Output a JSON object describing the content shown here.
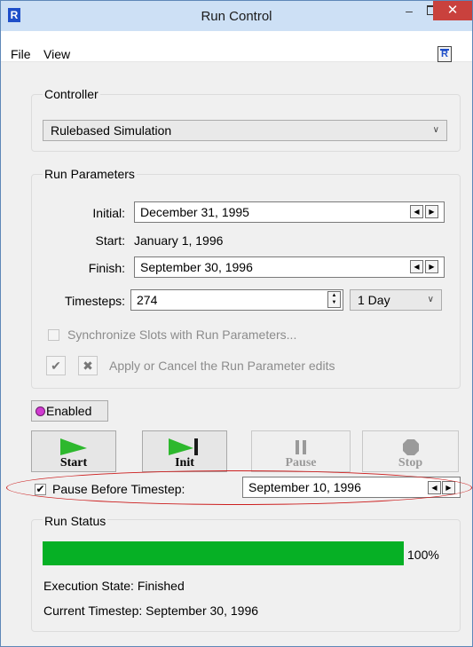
{
  "window": {
    "title": "Run Control",
    "app_icon_letter": "R",
    "minimize_glyph": "–",
    "close_glyph": "✕"
  },
  "menu": {
    "file": "File",
    "view": "View",
    "icon_letter": "R"
  },
  "controller": {
    "group_title": "Controller",
    "selected": "Rulebased Simulation"
  },
  "run_parameters": {
    "group_title": "Run Parameters",
    "initial_label": "Initial:",
    "initial_value": "December 31, 1995",
    "start_label": "Start:",
    "start_value": "January 1, 1996",
    "finish_label": "Finish:",
    "finish_value": "September 30, 1996",
    "timesteps_label": "Timesteps:",
    "timesteps_value": "274",
    "timestep_unit": "1 Day",
    "sync_label": "Synchronize Slots with Run Parameters...",
    "apply_cancel_label": "Apply or Cancel the Run Parameter edits"
  },
  "enabled_label": "Enabled",
  "controls": {
    "start": "Start",
    "init": "Init",
    "pause": "Pause",
    "stop": "Stop"
  },
  "pause_before": {
    "label": "Pause Before Timestep:",
    "value": "September 10, 1996",
    "checked": true
  },
  "run_status": {
    "group_title": "Run Status",
    "progress_percent": 100,
    "progress_label": "100%",
    "execution_state": "Execution State: Finished",
    "current_timestep": "Current Timestep: September 30, 1996"
  },
  "colors": {
    "progress": "#06b025",
    "titlebar": "#cde0f5",
    "close": "#c9413d",
    "highlight": "#cc1f1f",
    "play_green": "#2db82d"
  }
}
